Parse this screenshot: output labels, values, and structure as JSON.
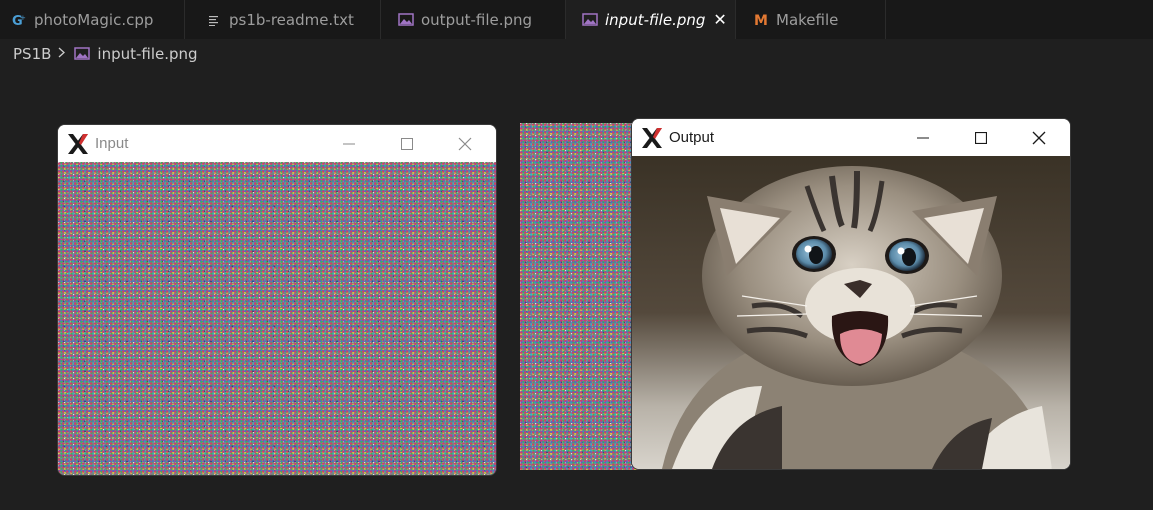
{
  "tabs": [
    {
      "label": "photoMagic.cpp",
      "icon": "cpp-file-icon",
      "active": false
    },
    {
      "label": "ps1b-readme.txt",
      "icon": "text-file-icon",
      "active": false
    },
    {
      "label": "output-file.png",
      "icon": "image-file-icon",
      "active": false
    },
    {
      "label": "input-file.png",
      "icon": "image-file-icon",
      "active": true
    },
    {
      "label": "Makefile",
      "icon": "makefile-icon",
      "active": false
    }
  ],
  "breadcrumb": {
    "folder": "PS1B",
    "file": "input-file.png"
  },
  "windows": {
    "input": {
      "title": "Input",
      "content": "random-noise-image"
    },
    "output": {
      "title": "Output",
      "content": "kitten-photo"
    }
  },
  "colors": {
    "accent": "#c586c0",
    "cpp": "#4b9fd6",
    "makefile": "#e37933",
    "background": "#1f1f1f"
  }
}
